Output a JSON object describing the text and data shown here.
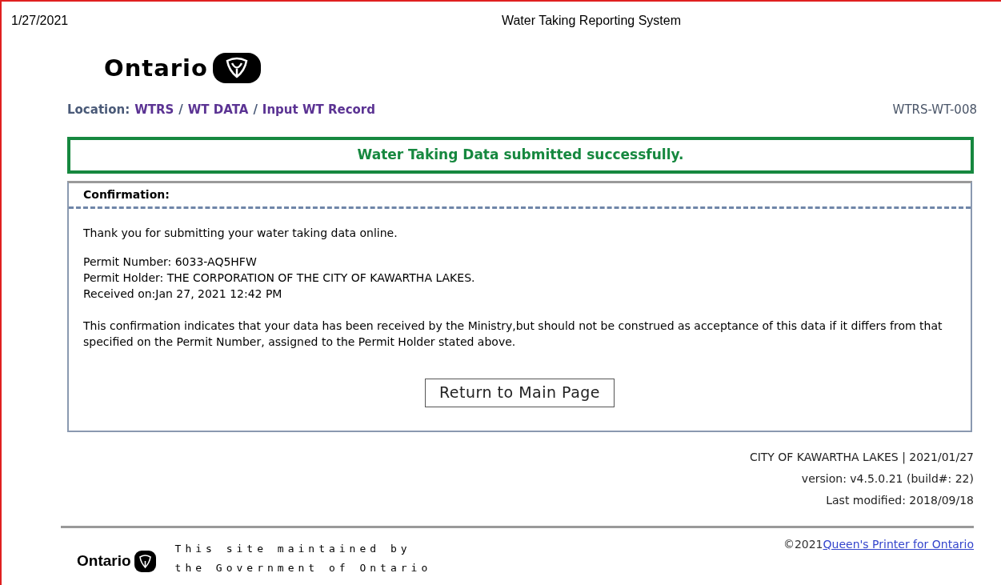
{
  "print_header": {
    "date": "1/27/2021",
    "title": "Water Taking Reporting System"
  },
  "logo": {
    "wordmark": "Ontario"
  },
  "location": {
    "label": "Location:",
    "crumbs": [
      "WTRS",
      "WT DATA",
      "Input WT Record"
    ],
    "separator": "/"
  },
  "screen_id": "WTRS-WT-008",
  "success_message": "Water Taking Data submitted successfully.",
  "confirmation": {
    "heading": "Confirmation:",
    "thanks": "Thank you for submitting your water taking data online.",
    "details": [
      "Permit Number: 6033-AQ5HFW",
      "Permit Holder: THE CORPORATION OF THE CITY OF KAWARTHA LAKES.",
      "Received on:Jan 27, 2021 12:42 PM"
    ],
    "notice": "This confirmation indicates that your data has been received by the Ministry,but should not be construed as acceptance of this data if it differs from that specified on the Permit Number, assigned to the Permit Holder stated above.",
    "button": "Return to Main Page"
  },
  "meta": [
    "CITY OF KAWARTHA LAKES | 2021/01/27",
    "version: v4.5.0.21 (build#: 22)",
    "Last modified: 2018/09/18"
  ],
  "footer": {
    "wordmark": "Ontario",
    "maintained": [
      "This site maintained by",
      "the Government of Ontario"
    ],
    "copyright": "©2021",
    "link": "Queen's Printer for Ontario"
  }
}
